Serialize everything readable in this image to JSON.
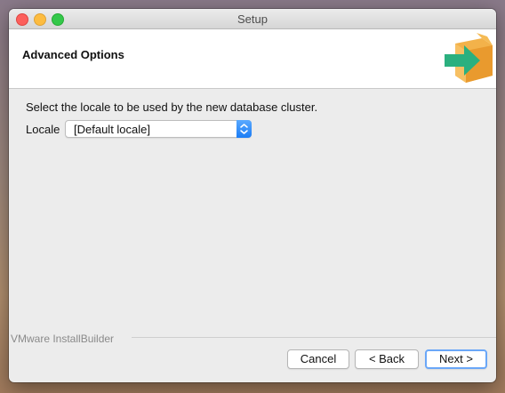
{
  "window": {
    "title": "Setup"
  },
  "header": {
    "title": "Advanced Options",
    "logo_icon": "installer-box-arrow-icon"
  },
  "content": {
    "description": "Select the locale to be used by the new database cluster.",
    "locale_label": "Locale",
    "locale_selected": "[Default locale]"
  },
  "footer": {
    "brand": "VMware InstallBuilder",
    "cancel_label": "Cancel",
    "back_label": "< Back",
    "next_label": "Next >"
  },
  "colors": {
    "accent_blue": "#1a7cf5",
    "logo_green": "#2bb07f",
    "logo_orange": "#f0a43a"
  }
}
